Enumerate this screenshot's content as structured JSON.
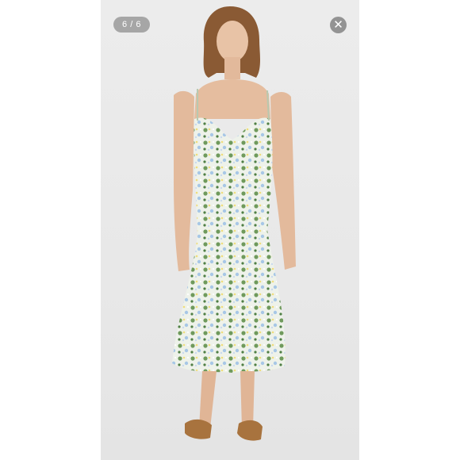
{
  "viewer": {
    "counter": "6 / 6",
    "close_symbol": "✕",
    "close_icon": "close-icon"
  },
  "colors": {
    "backdrop": "#ffffff",
    "photo_background": "#e9e9e9",
    "overlay_chip": "#6e6e6e"
  }
}
